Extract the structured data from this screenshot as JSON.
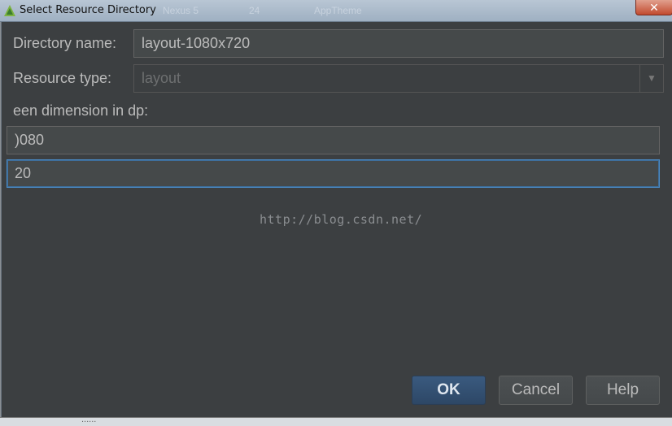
{
  "window": {
    "title": "Select Resource Directory",
    "close_symbol": "✕"
  },
  "background_toolbar": {
    "device": "Nexus 5",
    "api": "24",
    "theme": "AppTheme"
  },
  "form": {
    "directory_name_label": "Directory name:",
    "directory_name_value": "layout-1080x720",
    "resource_type_label": "Resource type:",
    "resource_type_value": "layout",
    "screen_dimension_label": "een dimension in dp:",
    "width_value": ")080",
    "height_value": "20"
  },
  "watermark": "http://blog.csdn.net/",
  "buttons": {
    "ok": "OK",
    "cancel": "Cancel",
    "help": "Help"
  },
  "bottom_strip_text": "......"
}
